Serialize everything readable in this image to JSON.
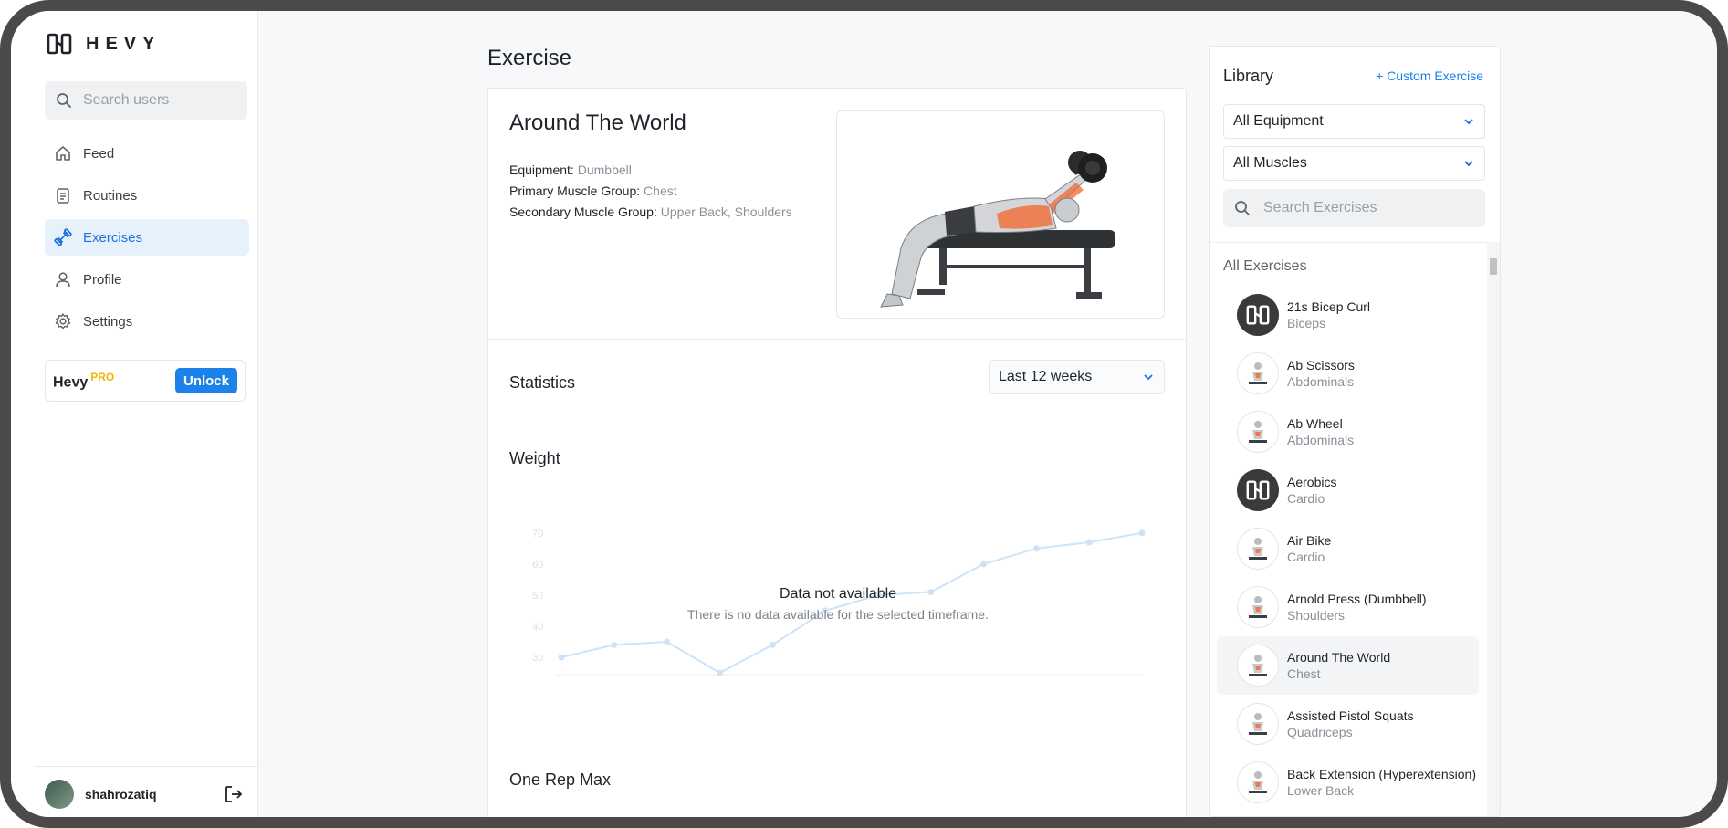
{
  "app": {
    "logo_text": "HEVY"
  },
  "sidebar": {
    "search_placeholder": "Search users",
    "items": [
      {
        "label": "Feed",
        "icon": "home-icon"
      },
      {
        "label": "Routines",
        "icon": "clipboard-icon"
      },
      {
        "label": "Exercises",
        "icon": "dumbbell-icon",
        "active": true
      },
      {
        "label": "Profile",
        "icon": "user-icon"
      },
      {
        "label": "Settings",
        "icon": "gear-icon"
      }
    ],
    "pro": {
      "brand": "Hevy",
      "badge": "PRO",
      "button": "Unlock"
    },
    "user": {
      "name": "shahrozatiq"
    }
  },
  "main": {
    "page_title": "Exercise",
    "exercise": {
      "name": "Around The World",
      "equipment_label": "Equipment:",
      "equipment": "Dumbbell",
      "primary_label": "Primary Muscle Group:",
      "primary": "Chest",
      "secondary_label": "Secondary Muscle Group:",
      "secondary": "Upper Back, Shoulders"
    },
    "statistics": {
      "title": "Statistics",
      "range": "Last 12 weeks",
      "weight_title": "Weight",
      "empty_title": "Data not available",
      "empty_sub": "There is no data available for the selected timeframe.",
      "one_rep_title": "One Rep Max"
    }
  },
  "chart_data": {
    "type": "line",
    "title": "Weight",
    "y_ticks": [
      "70",
      "60",
      "50",
      "40",
      "30"
    ],
    "ylim": [
      25,
      72
    ],
    "values": [
      30,
      34,
      35,
      25,
      34,
      45,
      50,
      51,
      60,
      65,
      67,
      70
    ],
    "grid": false,
    "placeholder": true
  },
  "library": {
    "title": "Library",
    "custom_link": "+ Custom Exercise",
    "equipment_select": "All Equipment",
    "muscles_select": "All Muscles",
    "search_placeholder": "Search Exercises",
    "section": "All Exercises",
    "exercises": [
      {
        "name": "21s Bicep Curl",
        "muscle": "Biceps",
        "thumb": "logo"
      },
      {
        "name": "Ab Scissors",
        "muscle": "Abdominals",
        "thumb": "image"
      },
      {
        "name": "Ab Wheel",
        "muscle": "Abdominals",
        "thumb": "image"
      },
      {
        "name": "Aerobics",
        "muscle": "Cardio",
        "thumb": "logo"
      },
      {
        "name": "Air Bike",
        "muscle": "Cardio",
        "thumb": "image"
      },
      {
        "name": "Arnold Press (Dumbbell)",
        "muscle": "Shoulders",
        "thumb": "image"
      },
      {
        "name": "Around The World",
        "muscle": "Chest",
        "thumb": "image",
        "selected": true
      },
      {
        "name": "Assisted Pistol Squats",
        "muscle": "Quadriceps",
        "thumb": "image"
      },
      {
        "name": "Back Extension (Hyperextension)",
        "muscle": "Lower Back",
        "thumb": "image"
      }
    ]
  },
  "colors": {
    "accent": "#1a82e8",
    "pro_badge": "#f5b800",
    "active_nav_bg": "#e6f1fc"
  }
}
